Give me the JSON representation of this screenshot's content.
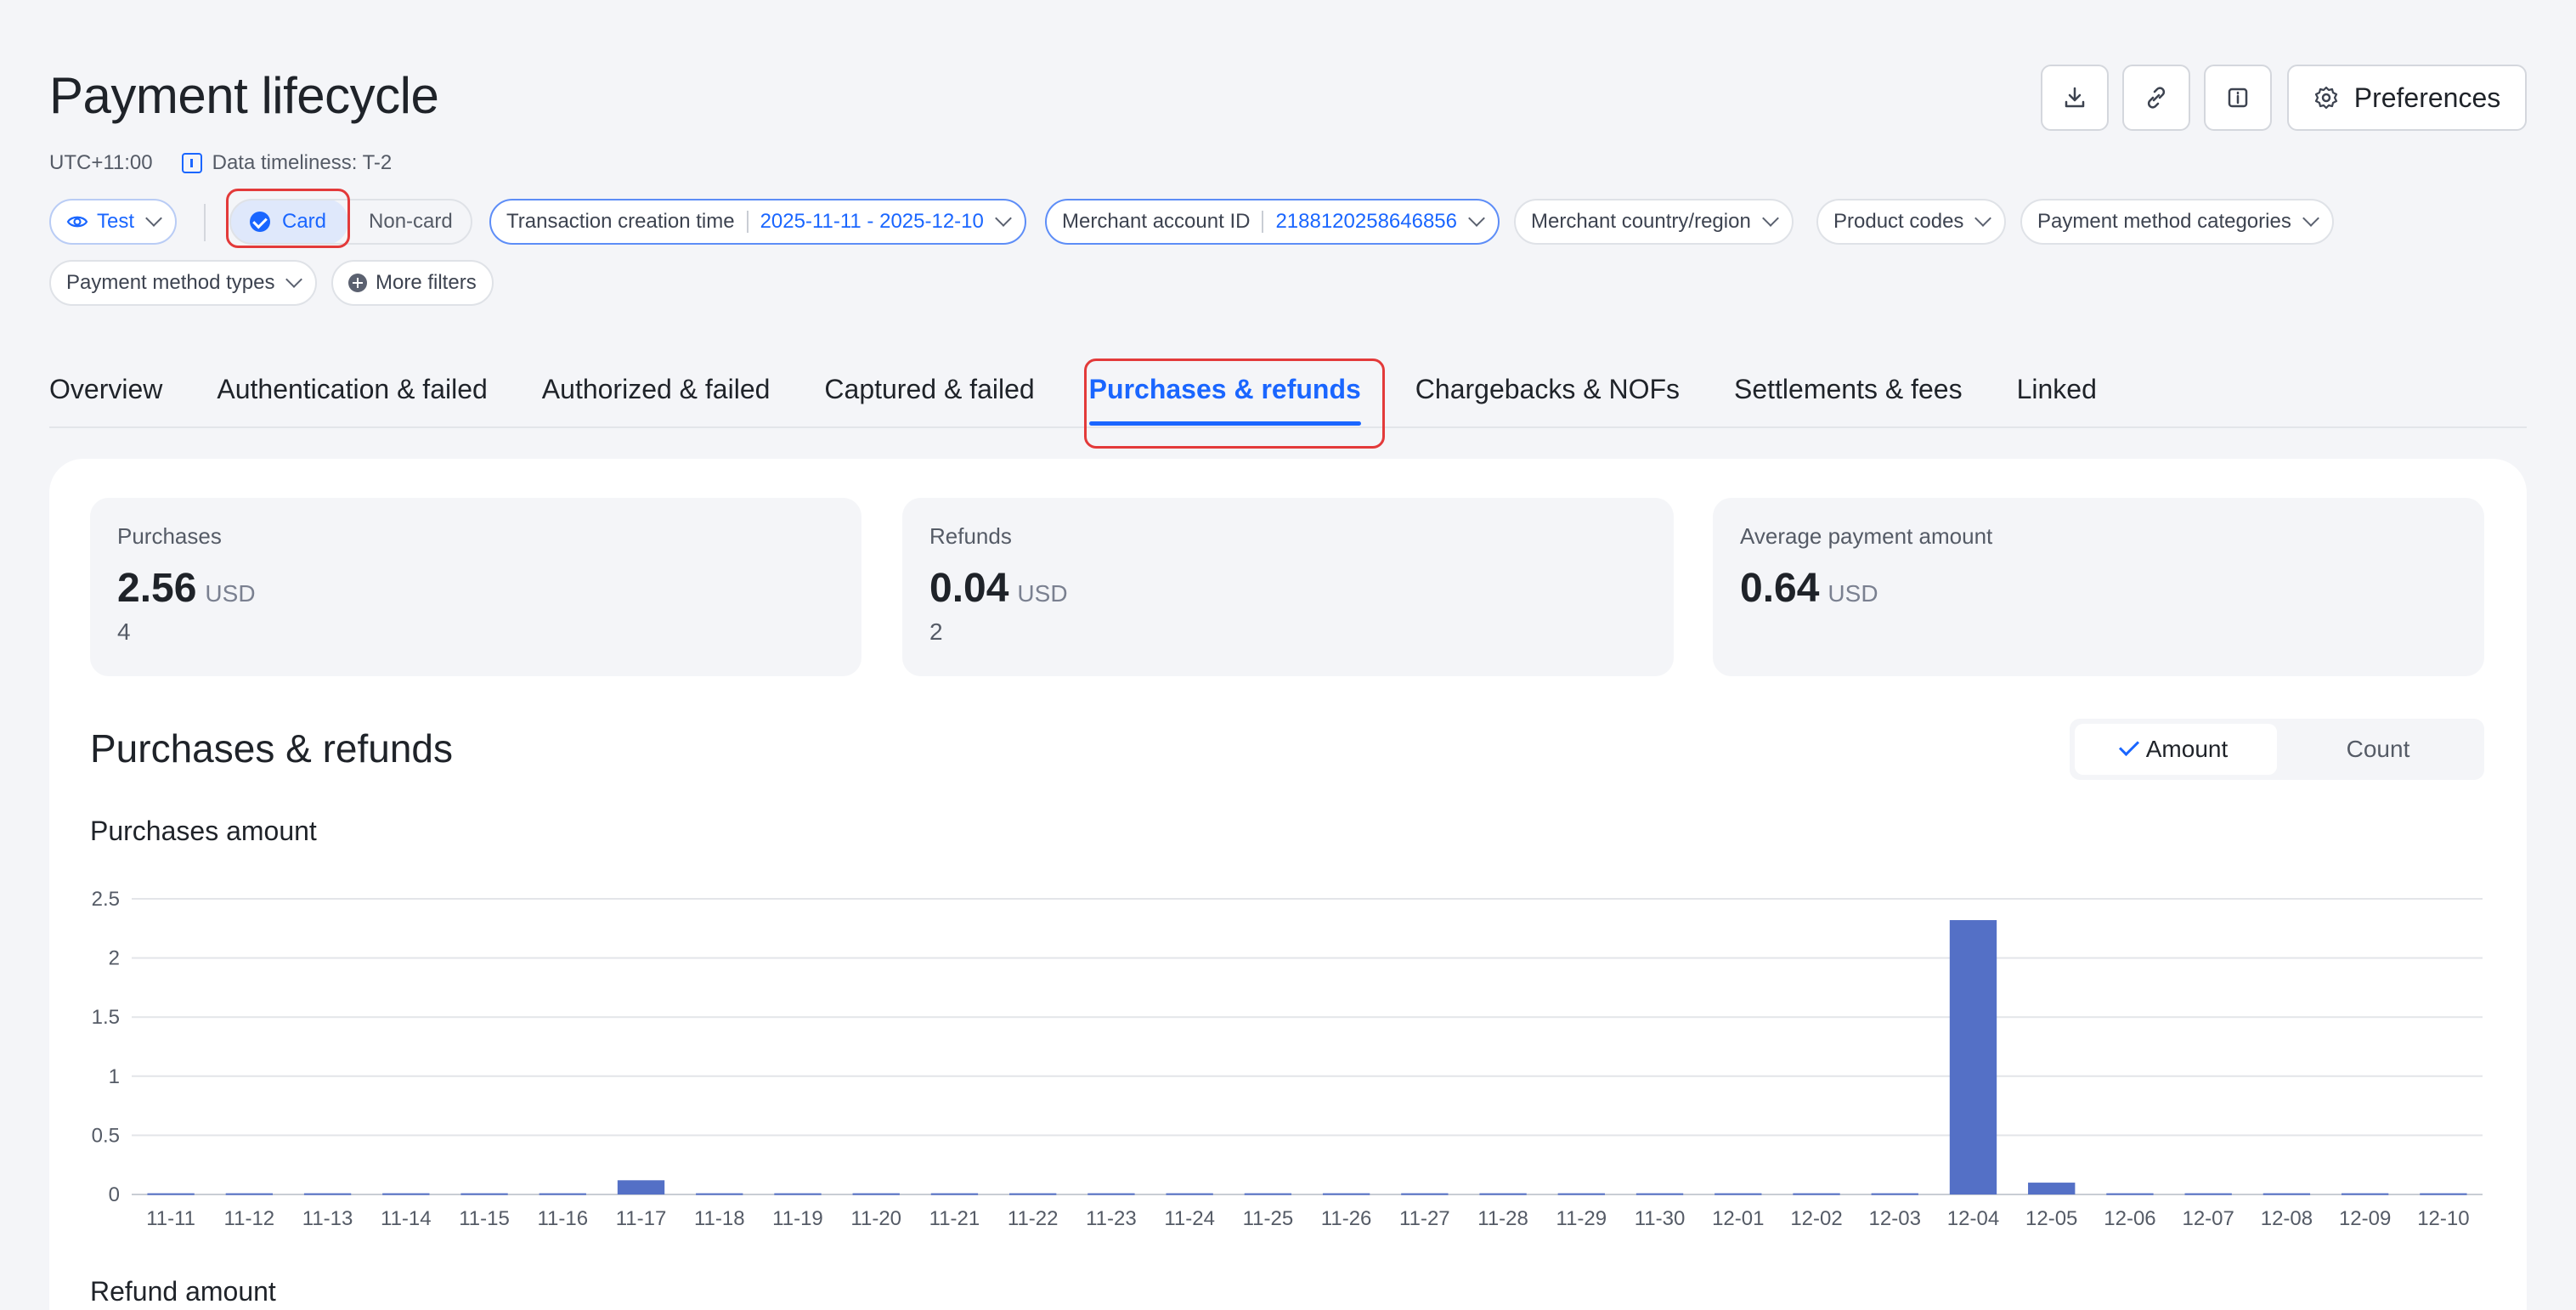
{
  "header": {
    "title": "Payment lifecycle",
    "timezone": "UTC+11:00",
    "timeliness": "Data timeliness: T-2",
    "preferences_label": "Preferences"
  },
  "filters": {
    "env": "Test",
    "card": "Card",
    "noncard": "Non-card",
    "txn_time_label": "Transaction creation time",
    "txn_time_value": "2025-11-11 - 2025-12-10",
    "merchant_id_label": "Merchant account ID",
    "merchant_id_value": "2188120258646856",
    "country": "Merchant country/region",
    "product_codes": "Product codes",
    "pm_categories": "Payment method categories",
    "pm_types": "Payment method types",
    "more": "More filters"
  },
  "tabs": [
    {
      "label": "Overview"
    },
    {
      "label": "Authentication & failed"
    },
    {
      "label": "Authorized & failed"
    },
    {
      "label": "Captured & failed"
    },
    {
      "label": "Purchases & refunds",
      "active": true
    },
    {
      "label": "Chargebacks & NOFs"
    },
    {
      "label": "Settlements & fees"
    },
    {
      "label": "Linked"
    }
  ],
  "stats": [
    {
      "label": "Purchases",
      "value": "2.56",
      "currency": "USD",
      "count": "4"
    },
    {
      "label": "Refunds",
      "value": "0.04",
      "currency": "USD",
      "count": "2"
    },
    {
      "label": "Average payment amount",
      "value": "0.64",
      "currency": "USD",
      "count": ""
    }
  ],
  "section": {
    "title": "Purchases & refunds",
    "toggle_amount": "Amount",
    "toggle_count": "Count",
    "chart1_title": "Purchases amount",
    "chart2_title": "Refund amount"
  },
  "colors": {
    "accent": "#1a66ff",
    "bar": "#5470c6",
    "highlight": "#e33a3a"
  },
  "chart_data": {
    "type": "bar",
    "title": "Purchases amount",
    "categories": [
      "11-11",
      "11-12",
      "11-13",
      "11-14",
      "11-15",
      "11-16",
      "11-17",
      "11-18",
      "11-19",
      "11-20",
      "11-21",
      "11-22",
      "11-23",
      "11-24",
      "11-25",
      "11-26",
      "11-27",
      "11-28",
      "11-29",
      "11-30",
      "12-01",
      "12-02",
      "12-03",
      "12-04",
      "12-05",
      "12-06",
      "12-07",
      "12-08",
      "12-09",
      "12-10"
    ],
    "values": [
      0.01,
      0.01,
      0.01,
      0.01,
      0.01,
      0.01,
      0.12,
      0.01,
      0.01,
      0.01,
      0.01,
      0.01,
      0.01,
      0.01,
      0.01,
      0.01,
      0.01,
      0.01,
      0.01,
      0.01,
      0.01,
      0.01,
      0.01,
      2.32,
      0.1,
      0.01,
      0.01,
      0.01,
      0.01,
      0.01
    ],
    "yticks": [
      "0",
      "0.5",
      "1",
      "1.5",
      "2",
      "2.5"
    ],
    "ylim": [
      0,
      2.5
    ],
    "grid": true
  }
}
